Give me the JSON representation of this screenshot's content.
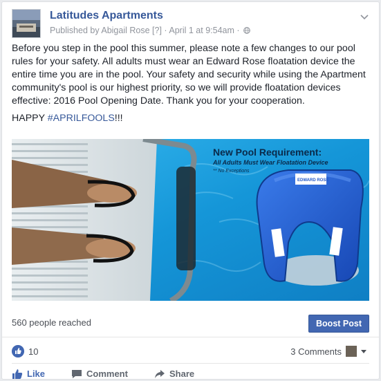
{
  "post": {
    "page_name": "Latitudes Apartments",
    "meta": {
      "published_by": "Published by Abigail Rose",
      "help": "[?]",
      "timestamp": "April 1 at 9:54am",
      "separator": "·",
      "audience_icon": "globe-icon"
    },
    "body_paragraph": "Before you step in the pool this summer, please note a few changes to our pool rules for your safety. All adults must wear an Edward Rose floatation device the entire time you are in the pool. Your safety and security while using the Apartment community's pool is our highest priority, so we will provide floatation devices effective: 2016 Pool Opening Date. Thank you for your cooperation.",
    "happy_prefix": "HAPPY ",
    "hashtag": "#APRILFOOLS",
    "happy_suffix": "!!!",
    "image": {
      "headline": "New Pool Requirement:",
      "subheadline": "All Adults Must Wear Floatation Device",
      "note": "** No Exceptions",
      "float_brand": "EDWARD ROSE"
    }
  },
  "insights": {
    "reach": "560 people reached",
    "boost_label": "Boost Post"
  },
  "reactions": {
    "like_count": "10",
    "comments": "3 Comments"
  },
  "actions": {
    "like": "Like",
    "comment": "Comment",
    "share": "Share"
  },
  "colors": {
    "link": "#365899",
    "boost_bg": "#4267b2",
    "pool_blue": "#1aa3e0",
    "float_blue": "#1f57c8"
  }
}
